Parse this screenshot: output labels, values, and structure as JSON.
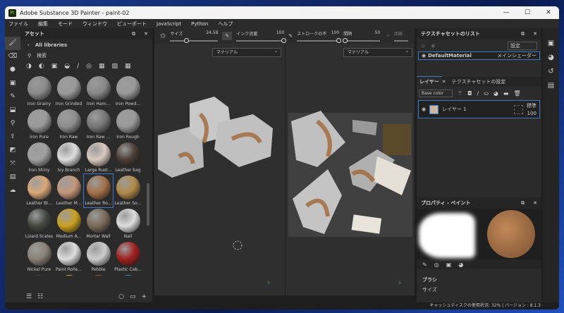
{
  "window": {
    "title": "Adobe Substance 3D Painter - paint-02",
    "app_icon": "Pt"
  },
  "menu": [
    "ファイル",
    "編集",
    "モード",
    "ウィンドウ",
    "ビューポート",
    "JavaScript",
    "Python",
    "ヘルプ"
  ],
  "assets": {
    "title": "アセット",
    "libraries": "All libraries",
    "search_placeholder": "検索",
    "items": [
      {
        "name": "Iron Grainy",
        "color": "#8a8a8a"
      },
      {
        "name": "Iron Grinded",
        "color": "#999"
      },
      {
        "name": "Iron Ham...",
        "color": "#888"
      },
      {
        "name": "Iron Powd...",
        "color": "#999"
      },
      {
        "name": "Iron Pure",
        "color": "#9a9a9a"
      },
      {
        "name": "Iron Raw",
        "color": "#8e8e8e"
      },
      {
        "name": "Iron Raw ...",
        "color": "#777"
      },
      {
        "name": "Iron Rough",
        "color": "#999"
      },
      {
        "name": "Iron Shiny",
        "color": "#a0a0a0"
      },
      {
        "name": "Ivy Branch",
        "color": "#ddd"
      },
      {
        "name": "Large Rust...",
        "color": "#d8c8c0"
      },
      {
        "name": "Leather bag",
        "color": "#4a3d35"
      },
      {
        "name": "Leather Bl...",
        "color": "#d9a878"
      },
      {
        "name": "Leather M...",
        "color": "#c4977a"
      },
      {
        "name": "Leather Ro...",
        "color": "#a47048"
      },
      {
        "name": "Leather So...",
        "color": "#b08a4a"
      },
      {
        "name": "Lizard Scales",
        "color": "#444842"
      },
      {
        "name": "Medium A...",
        "color": "#c9a020"
      },
      {
        "name": "Mortar Wall",
        "color": "#7a6a58"
      },
      {
        "name": "Nail",
        "color": "#ddd"
      },
      {
        "name": "Nickel Pure",
        "color": "#8a8278"
      },
      {
        "name": "Paint Rolle...",
        "color": "#ddd"
      },
      {
        "name": "Pebble",
        "color": "#ccc"
      },
      {
        "name": "Plastic Cab...",
        "color": "#a02020"
      },
      {
        "name": "",
        "color": "#222"
      },
      {
        "name": "",
        "color": "#d8b820"
      },
      {
        "name": "",
        "color": "#a0501a"
      },
      {
        "name": "",
        "color": "#1a80e0"
      }
    ],
    "selected_index": 14
  },
  "toolbar": {
    "size_label": "サイズ",
    "size_value": "24.58",
    "size_pct": 35,
    "flow_label": "インク流量",
    "flow_value": "100",
    "flow_pct": 100,
    "stroke_label": "ストロークの不",
    "stroke_value": "100",
    "stroke_pct": 100,
    "spacing_label": "間隔",
    "spacing_value": "50",
    "spacing_pct": 5,
    "distance_label": "距離"
  },
  "viewport": {
    "left_mode": "マテリアル",
    "right_mode": "マテリアル"
  },
  "texture_sets": {
    "title": "テクスチャセットのリスト",
    "settings": "設定",
    "material": "DefaultMaterial",
    "shader": "メインシェーダー"
  },
  "layers": {
    "tab_layers": "レイヤー",
    "tab_settings": "テクスチャセットの設定",
    "channel": "Base color",
    "layer_name": "レイヤー 1",
    "blend": "標準",
    "opacity": "100"
  },
  "properties": {
    "title": "プロパティ - ペイント",
    "section": "ブラシ",
    "size_label": "サイズ"
  },
  "status": "キャッシュディスクの使用状況: 32% | バージョン : 8.1.3"
}
